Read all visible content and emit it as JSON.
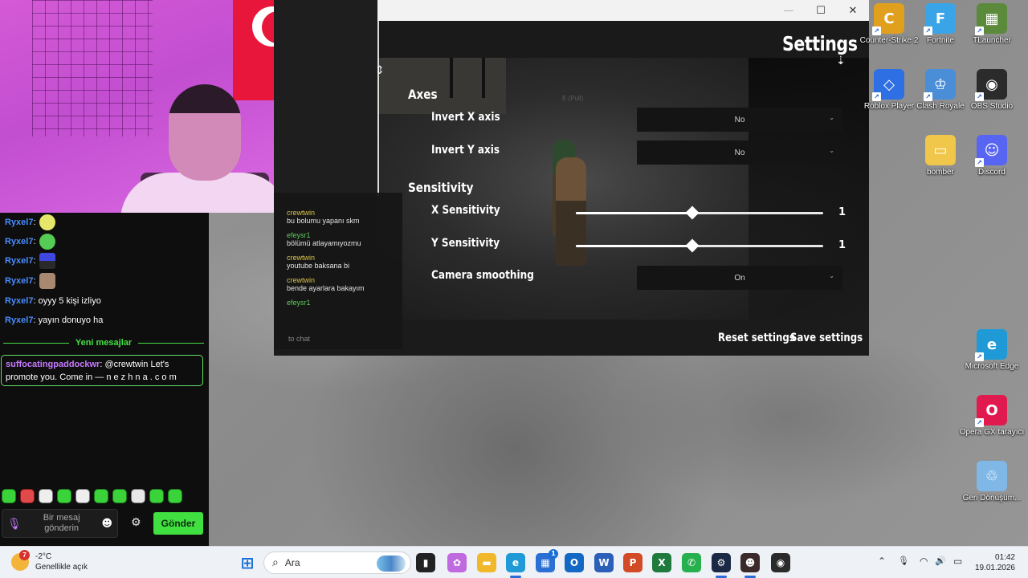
{
  "webcam": {
    "flag_star": "★"
  },
  "chat": {
    "messages": [
      {
        "user": "Ryxel7",
        "text": "",
        "emote": "e1"
      },
      {
        "user": "Ryxel7",
        "text": "",
        "emote": "e2"
      },
      {
        "user": "Ryxel7",
        "text": "",
        "emote": "e3"
      },
      {
        "user": "Ryxel7",
        "text": "",
        "emote": "e4"
      },
      {
        "user": "Ryxel7",
        "text": "oyyy 5 kişi izliyo"
      },
      {
        "user": "Ryxel7",
        "text": "yayın donuyo ha"
      }
    ],
    "divider_label": "Yeni mesajlar",
    "highlight": {
      "user": "suffocatingpaddockwr",
      "text": "@crewtwin Let's promote  you. Come in — n e z h n a . c o m"
    },
    "input_placeholder": "Bir mesaj gönderin",
    "send_label": "Gönder",
    "mic_icon": "🎙",
    "smile_icon": "☻",
    "gear_icon": "⚙"
  },
  "game": {
    "title": "Settings",
    "window_controls": {
      "minimize": "—",
      "maximize": "☐",
      "close": "✕"
    },
    "sections": {
      "axes": "Axes",
      "sensitivity": "Sensitivity"
    },
    "options": {
      "invert_x": {
        "label": "Invert X axis",
        "value": "No"
      },
      "invert_y": {
        "label": "Invert Y axis",
        "value": "No"
      },
      "x_sens": {
        "label": "X Sensitivity",
        "value": "1",
        "fraction": 0.47
      },
      "y_sens": {
        "label": "Y Sensitivity",
        "value": "1",
        "fraction": 0.47
      },
      "camera_smoothing": {
        "label": "Camera smoothing",
        "value": "On"
      }
    },
    "chevron": "⌄",
    "reset_label": "Reset settings",
    "save_label": "Save settings",
    "scene_text": "E (Pull)",
    "ingame_chat": [
      {
        "user": "crewtwin",
        "text": "bu bolumu yapanı skm",
        "color": "yellow"
      },
      {
        "user": "efeysr1",
        "text": "bölümü atlayamıyozmu",
        "color": "green"
      },
      {
        "user": "crewtwin",
        "text": "youtube baksana bi",
        "color": "yellow"
      },
      {
        "user": "crewtwin",
        "text": "bende ayarlara bakayım",
        "color": "yellow"
      },
      {
        "user": "efeysr1",
        "text": "",
        "color": "green"
      }
    ],
    "ingame_input": "to chat"
  },
  "desktop": {
    "icons": [
      {
        "label": "Counter-Strike 2",
        "icon": "cs2-icon",
        "color": "#e0a01e",
        "glyph": "C"
      },
      {
        "label": "Fortnite",
        "icon": "fortnite-icon",
        "color": "#3aa4e8",
        "glyph": "F"
      },
      {
        "label": "TLauncher",
        "icon": "tlauncher-icon",
        "color": "#5a8a3a",
        "glyph": "▦"
      },
      {
        "label": "Roblox Player",
        "icon": "roblox-icon",
        "color": "#2f6fe4",
        "glyph": "◇"
      },
      {
        "label": "Clash Royale",
        "icon": "clash-royale-icon",
        "color": "#4b8ed8",
        "glyph": "♔"
      },
      {
        "label": "OBS Studio",
        "icon": "obs-icon",
        "color": "#2b2b2b",
        "glyph": "◉"
      },
      {
        "label": "bomber",
        "icon": "folder-icon",
        "color": "#f0c74a",
        "glyph": "▭"
      },
      {
        "label": "Discord",
        "icon": "discord-icon",
        "color": "#5865f2",
        "glyph": "☺"
      },
      {
        "label": "Microsoft Edge",
        "icon": "edge-icon",
        "color": "#1f9ad6",
        "glyph": "e"
      },
      {
        "label": "Opera GX tarayıcı",
        "icon": "opera-gx-icon",
        "color": "#e01a4f",
        "glyph": "O"
      },
      {
        "label": "Geri Dönüşüm...",
        "icon": "recycle-bin-icon",
        "color": "#7fb8e6",
        "glyph": "♲"
      }
    ]
  },
  "taskbar": {
    "weather_temp": "-2°C",
    "weather_desc": "Genellikle açık",
    "weather_badge": "7",
    "search_label": "Ara",
    "search_icon": "⌕",
    "time": "01:42",
    "date": "19.01.2026",
    "tray_up": "⌃",
    "tray_mic": "🎙",
    "tray_wifi": "◠",
    "tray_volume": "🔊",
    "tray_battery": "▭",
    "start_glyph": "⊞",
    "apps": [
      {
        "name": "task-view-icon",
        "glyph": "▮",
        "color": "#222"
      },
      {
        "name": "copilot-icon",
        "glyph": "✿",
        "color": "#c06ae0"
      },
      {
        "name": "file-explorer-icon",
        "glyph": "▬",
        "color": "#f0b82a"
      },
      {
        "name": "edge-taskbar-icon",
        "glyph": "e",
        "color": "#1f9ad6"
      },
      {
        "name": "store-icon",
        "glyph": "▦",
        "color": "#2c6fd4"
      },
      {
        "name": "outlook-icon",
        "glyph": "O",
        "color": "#1368c4"
      },
      {
        "name": "word-icon",
        "glyph": "W",
        "color": "#2b5fb8"
      },
      {
        "name": "powerpoint-icon",
        "glyph": "P",
        "color": "#d24a26"
      },
      {
        "name": "excel-icon",
        "glyph": "X",
        "color": "#1f7a3e"
      },
      {
        "name": "whatsapp-icon",
        "glyph": "✆",
        "color": "#27b04e"
      },
      {
        "name": "steam-icon",
        "glyph": "⚙",
        "color": "#1b2a44"
      },
      {
        "name": "game-taskbar-icon",
        "glyph": "☻",
        "color": "#3a2a2a"
      },
      {
        "name": "obs-taskbar-icon",
        "glyph": "◉",
        "color": "#2b2b2b"
      }
    ],
    "store_badge": "1"
  }
}
